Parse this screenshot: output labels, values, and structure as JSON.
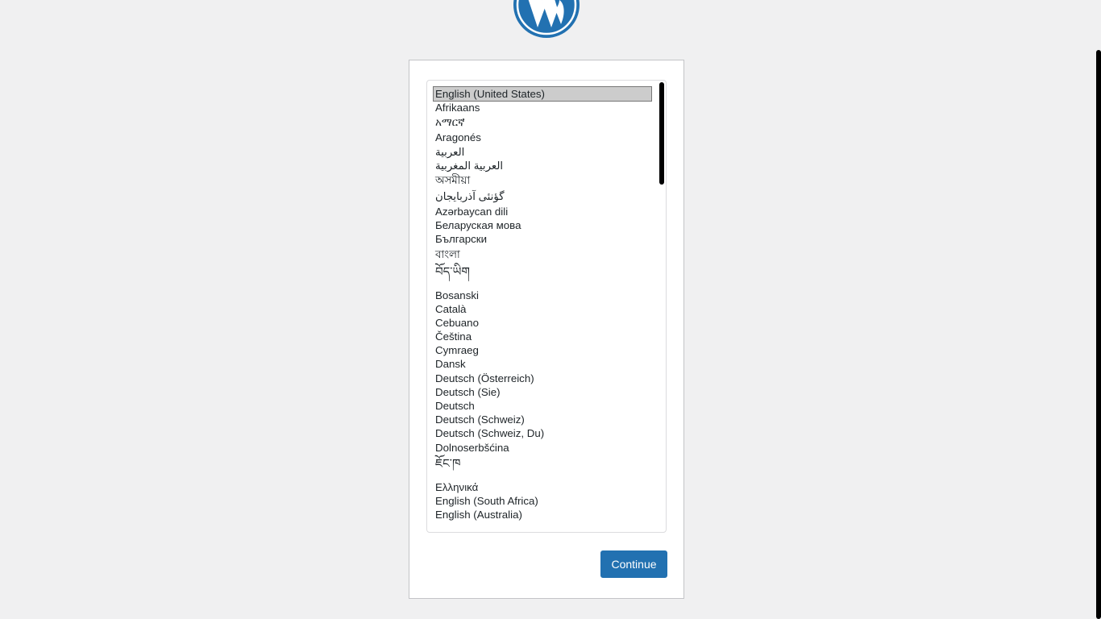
{
  "logo": {
    "icon": "wordpress-logo-icon",
    "color": "#2271b1"
  },
  "languages": {
    "selected_index": 0,
    "items": [
      "English (United States)",
      "Afrikaans",
      "አማርኛ",
      "Aragonés",
      "العربية",
      "العربية المغربية",
      "অসমীয়া",
      "گؤنئی آذربایجان",
      "Azərbaycan dili",
      "Беларуская мова",
      "Български",
      "বাংলা",
      "བོད་ཡིག",
      "Bosanski",
      "Català",
      "Cebuano",
      "Čeština",
      "Cymraeg",
      "Dansk",
      "Deutsch (Österreich)",
      "Deutsch (Sie)",
      "Deutsch",
      "Deutsch (Schweiz)",
      "Deutsch (Schweiz, Du)",
      "Dolnoserbšćina",
      "ཇོང་ཁ",
      "Ελληνικά",
      "English (South Africa)",
      "English (Australia)"
    ]
  },
  "actions": {
    "continue_label": "Continue"
  },
  "colors": {
    "primary": "#2271b1",
    "background": "#f0f0f1",
    "selected_row": "#cccccc"
  }
}
